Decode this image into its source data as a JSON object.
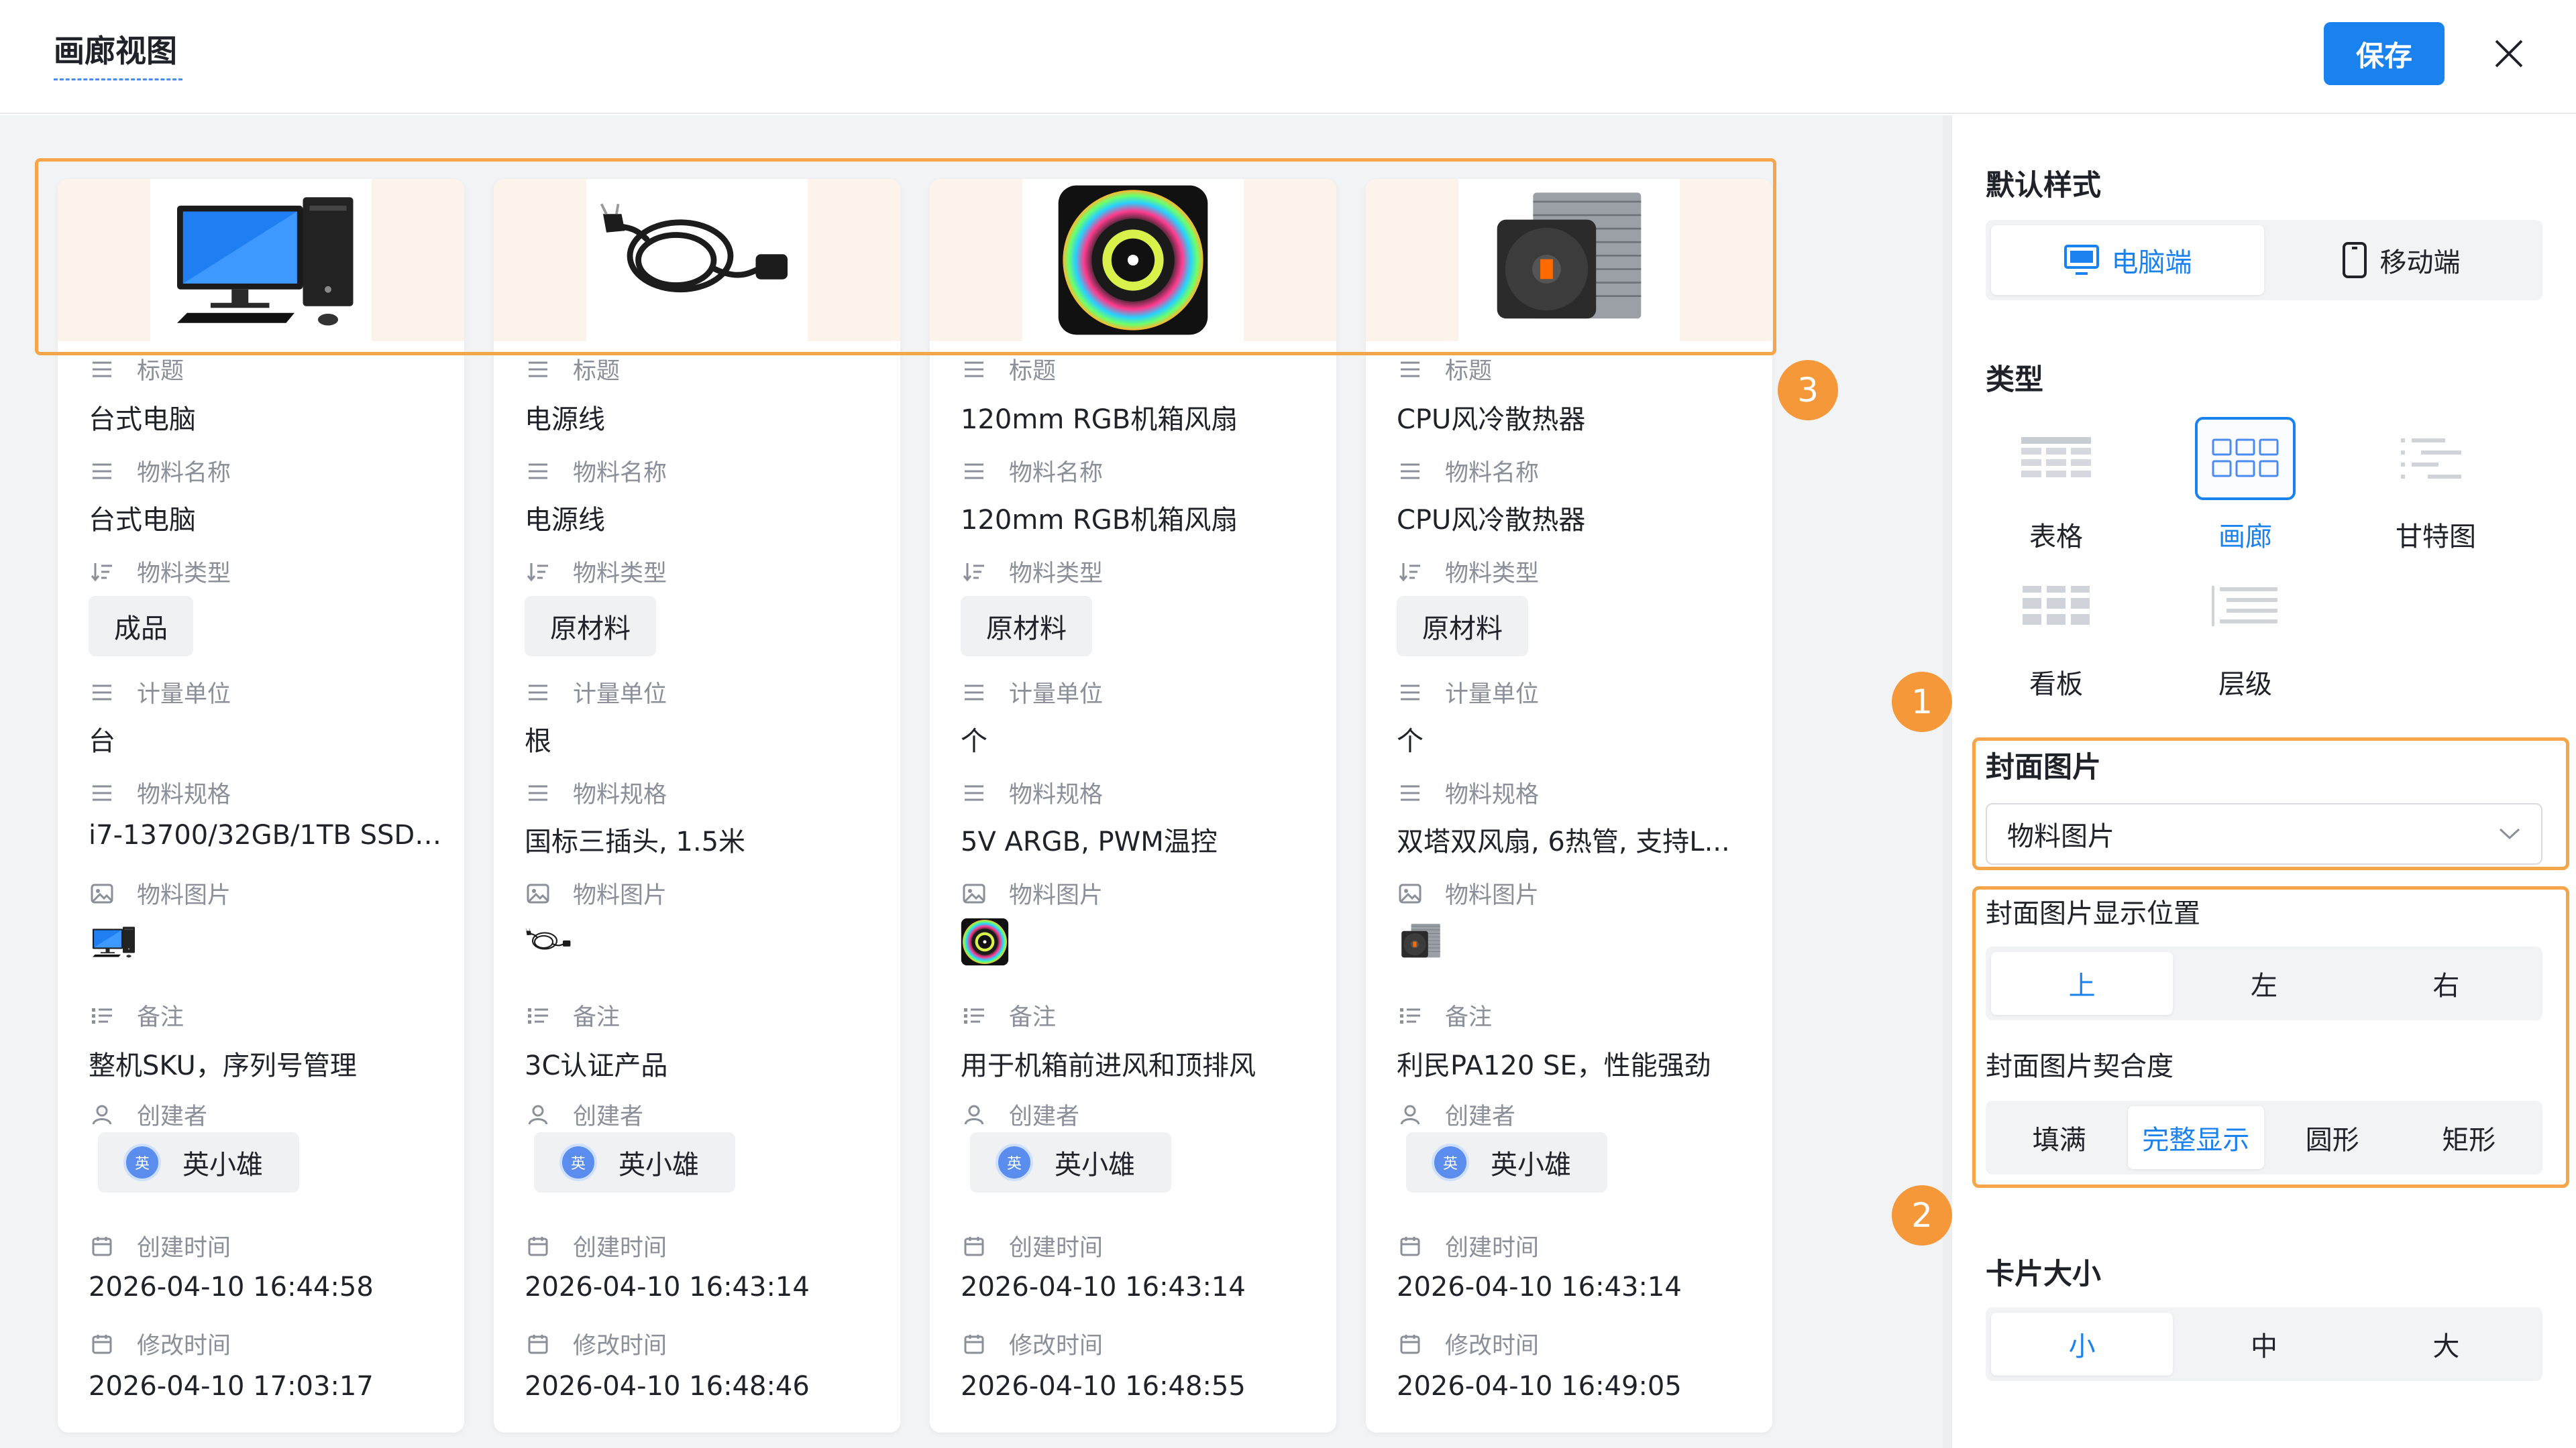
{
  "header": {
    "title": "画廊视图",
    "save_label": "保存"
  },
  "cards": [
    {
      "title": "台式电脑",
      "material_name": "台式电脑",
      "material_type": "成品",
      "unit": "台",
      "spec": "i7-13700/32GB/1TB SSD/...",
      "remark": "整机SKU，序列号管理",
      "creator": "英小雄",
      "created_at": "2026-04-10 16:44:58",
      "modified_at": "2026-04-10 17:03:17",
      "image": "desktop-computer"
    },
    {
      "title": "电源线",
      "material_name": "电源线",
      "material_type": "原材料",
      "unit": "根",
      "spec": "国标三插头, 1.5米",
      "remark": "3C认证产品",
      "creator": "英小雄",
      "created_at": "2026-04-10 16:43:14",
      "modified_at": "2026-04-10 16:48:46",
      "image": "power-cable"
    },
    {
      "title": "120mm RGB机箱风扇",
      "material_name": "120mm RGB机箱风扇",
      "material_type": "原材料",
      "unit": "个",
      "spec": "5V ARGB, PWM温控",
      "remark": "用于机箱前进风和顶排风",
      "creator": "英小雄",
      "created_at": "2026-04-10 16:43:14",
      "modified_at": "2026-04-10 16:48:55",
      "image": "rgb-fan"
    },
    {
      "title": "CPU风冷散热器",
      "material_name": "CPU风冷散热器",
      "material_type": "原材料",
      "unit": "个",
      "spec": "双塔双风扇, 6热管, 支持L...",
      "remark": "利民PA120 SE，性能强劲",
      "creator": "英小雄",
      "created_at": "2026-04-10 16:43:14",
      "modified_at": "2026-04-10 16:49:05",
      "image": "cpu-cooler"
    }
  ],
  "field_labels": {
    "title": "标题",
    "material_name": "物料名称",
    "material_type": "物料类型",
    "unit": "计量单位",
    "spec": "物料规格",
    "image": "物料图片",
    "remark": "备注",
    "creator": "创建者",
    "created_at": "创建时间",
    "modified_at": "修改时间"
  },
  "avatar_char": "英",
  "badges": [
    "1",
    "2",
    "3"
  ],
  "panel": {
    "default_style": "默认样式",
    "devices": [
      "电脑端",
      "移动端"
    ],
    "type_title": "类型",
    "types": [
      "表格",
      "画廊",
      "甘特图",
      "看板",
      "层级"
    ],
    "cover_title": "封面图片",
    "cover_value": "物料图片",
    "position_title": "封面图片显示位置",
    "positions": [
      "上",
      "左",
      "右"
    ],
    "fit_title": "封面图片契合度",
    "fits": [
      "填满",
      "完整显示",
      "圆形",
      "矩形"
    ],
    "size_title": "卡片大小",
    "sizes": [
      "小",
      "中",
      "大"
    ]
  },
  "colors": {
    "accent": "#1a82ef",
    "highlight": "#f7a54a",
    "badge": "#f5983a"
  }
}
